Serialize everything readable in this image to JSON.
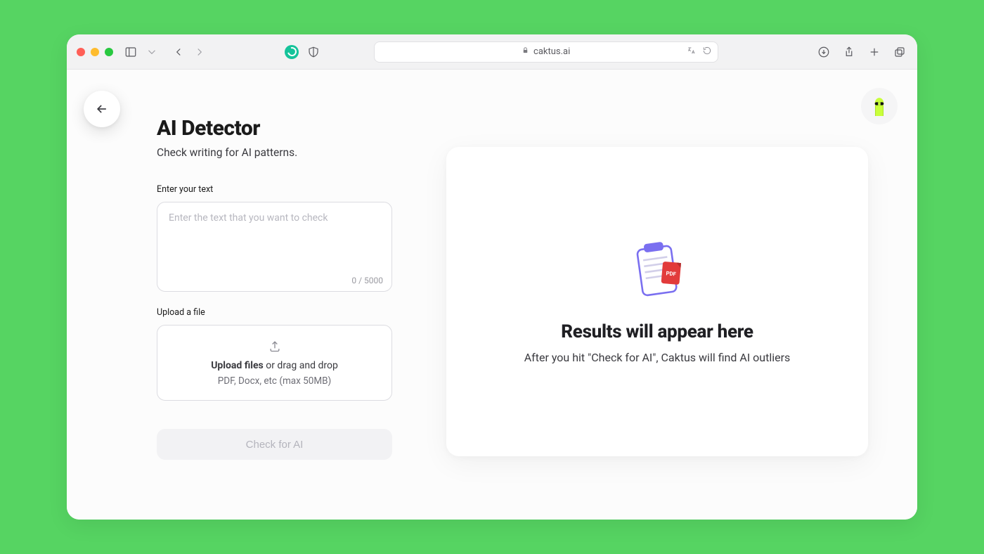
{
  "browser": {
    "url_host": "caktus.ai"
  },
  "page": {
    "title": "AI Detector",
    "subtitle": "Check writing for AI patterns."
  },
  "input": {
    "label": "Enter your text",
    "placeholder": "Enter the text that you want to check",
    "value": "",
    "counter": "0 / 5000"
  },
  "upload": {
    "label": "Upload a file",
    "line1_bold": "Upload files",
    "line1_rest": " or drag and drop",
    "line2": "PDF, Docx, etc (max 50MB)"
  },
  "action": {
    "check_label": "Check for AI"
  },
  "results": {
    "heading": "Results will appear here",
    "sub": "After you hit \"Check for AI\", Caktus will find AI outliers"
  }
}
